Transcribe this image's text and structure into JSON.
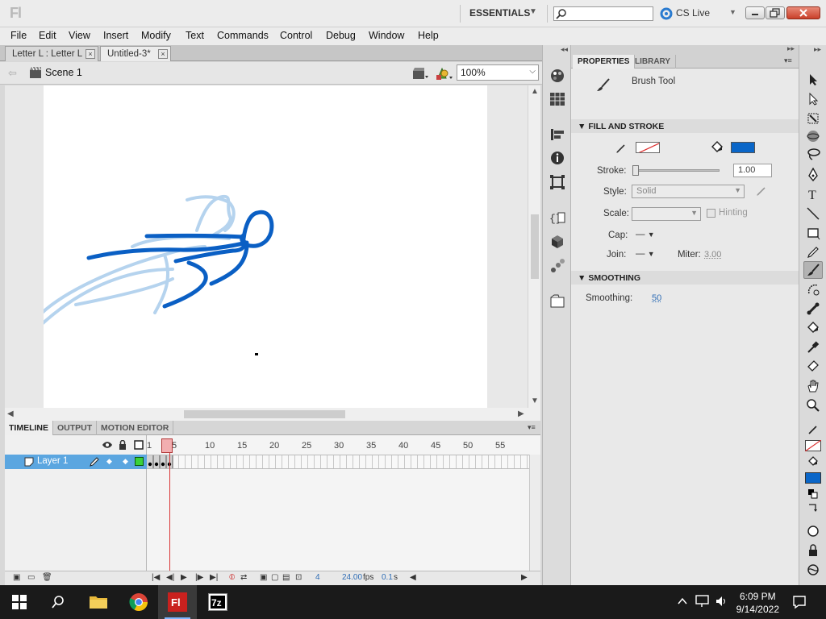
{
  "app": {
    "logo": "Fl",
    "workspace": "ESSENTIALS",
    "cs_live": "CS Live"
  },
  "menu": [
    "File",
    "Edit",
    "View",
    "Insert",
    "Modify",
    "Text",
    "Commands",
    "Control",
    "Debug",
    "Window",
    "Help"
  ],
  "doc_tabs": [
    {
      "label": "Letter L : Letter L",
      "active": false
    },
    {
      "label": "Untitled-3*",
      "active": true
    }
  ],
  "edit_bar": {
    "scene": "Scene 1",
    "zoom": "100%"
  },
  "timeline": {
    "tabs": [
      "TIMELINE",
      "OUTPUT",
      "MOTION EDITOR"
    ],
    "ruler": [
      "1",
      "5",
      "10",
      "15",
      "20",
      "25",
      "30",
      "35",
      "40",
      "45",
      "50",
      "55"
    ],
    "layer": "Layer 1",
    "current_frame": "4",
    "fps": "24.00",
    "fps_unit": "fps",
    "time": "0.1",
    "time_unit": "s"
  },
  "properties": {
    "tabs": [
      "PROPERTIES",
      "LIBRARY"
    ],
    "tool_name": "Brush Tool",
    "fill_stroke_header": "FILL AND STROKE",
    "stroke_label": "Stroke:",
    "stroke_value": "1.00",
    "style_label": "Style:",
    "style_value": "Solid",
    "scale_label": "Scale:",
    "hinting_label": "Hinting",
    "cap_label": "Cap:",
    "cap_value": "—",
    "join_label": "Join:",
    "join_value": "—",
    "miter_label": "Miter:",
    "miter_value": "3.00",
    "smoothing_header": "SMOOTHING",
    "smoothing_label": "Smoothing:",
    "smoothing_value": "50",
    "fill_color": "#0a66c8"
  },
  "taskbar": {
    "time": "6:09 PM",
    "date": "9/14/2022"
  },
  "colors": {
    "brush_blue": "#0a5fc4",
    "onion_blue": "#b5d3ee",
    "layer_highlight": "#5ba6e0"
  }
}
